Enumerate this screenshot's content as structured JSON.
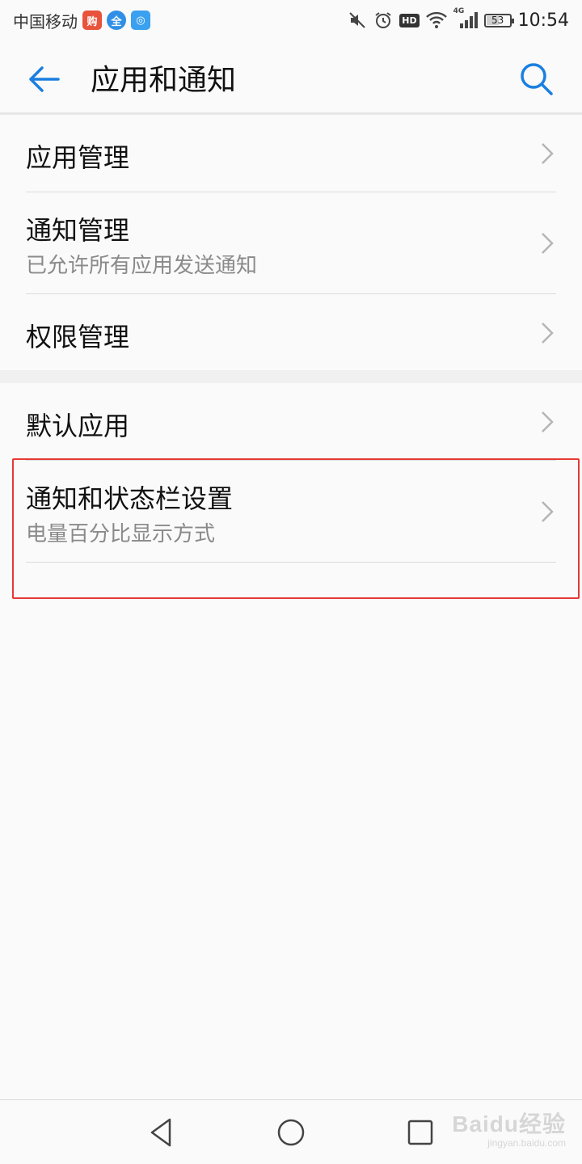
{
  "status_bar": {
    "carrier": "中国移动",
    "app_badges": [
      {
        "icon": "taobao-badge-icon",
        "text": "购",
        "color": "#e8533c"
      },
      {
        "icon": "quan-badge-icon",
        "text": "全",
        "color": "#2f8fe6"
      },
      {
        "icon": "wifi-hotspot-badge-icon",
        "text": "◎",
        "color": "#3aa0f0"
      }
    ],
    "hd_label": "HD",
    "network_label": "4G",
    "battery_level": "53",
    "time": "10:54"
  },
  "header": {
    "title": "应用和通知",
    "accent_color": "#1a7fe0"
  },
  "group1": {
    "items": [
      {
        "title": "应用管理",
        "subtitle": ""
      },
      {
        "title": "通知管理",
        "subtitle": "已允许所有应用发送通知"
      },
      {
        "title": "权限管理",
        "subtitle": ""
      }
    ]
  },
  "group2": {
    "items": [
      {
        "title": "默认应用",
        "subtitle": ""
      },
      {
        "title": "通知和状态栏设置",
        "subtitle": "电量百分比显示方式"
      }
    ]
  },
  "highlight_color": "#e53935",
  "watermark": {
    "main": "Baidu经验",
    "sub": "jingyan.baidu.com"
  }
}
